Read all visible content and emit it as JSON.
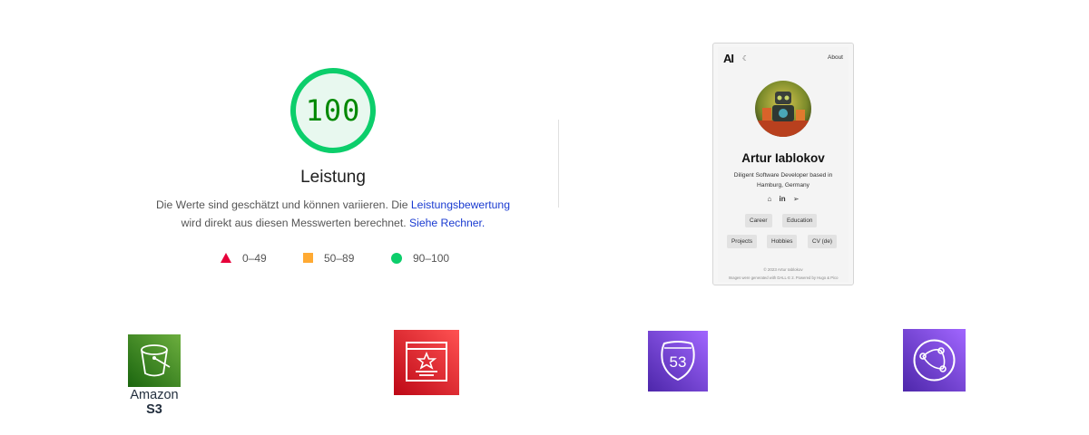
{
  "score": {
    "value": "100",
    "fraction": 1.0,
    "color": "#0cce6b",
    "category": "Leistung",
    "description_text": "Die Werte sind geschätzt und können variieren. Die ",
    "description_link1": "Leistungsbewertung",
    "description_text2": "wird direkt aus diesen Messwerten berechnet. ",
    "description_link2": "Siehe Rechner."
  },
  "legend": {
    "fail": {
      "label": "0–49",
      "color": "#e6003a",
      "icon": "triangle-icon"
    },
    "average": {
      "label": "50–89",
      "color": "#ffaa33",
      "icon": "square-icon"
    },
    "pass": {
      "label": "90–100",
      "color": "#0cce6b",
      "icon": "circle-icon"
    }
  },
  "screenshot": {
    "logo": "AI",
    "about": "About",
    "name": "Artur Iablokov",
    "bio_line1": "Diligent Software Developer based in",
    "bio_line2": "Hamburg, Germany",
    "icons": [
      "github-icon",
      "linkedin-icon",
      "telegram-icon"
    ],
    "chips": [
      "Career",
      "Education",
      "Projects",
      "Hobbies",
      "CV (de)"
    ],
    "footer1": "© 2023 Artur Iablokov",
    "footer2": "Images were generated with DALL·E 2. Powered by Hugo & Pico"
  },
  "aws": {
    "s3": {
      "icon": "amazon-s3-icon",
      "caption_line1": "Amazon",
      "caption_line2": "S3",
      "color": "#3f8624"
    },
    "certificate": {
      "icon": "aws-certificate-manager-icon",
      "color": "#c7131f"
    },
    "route53": {
      "icon": "amazon-route-53-icon",
      "badge": "53",
      "color": "#4d27aa"
    },
    "cloudfront": {
      "icon": "amazon-cloudfront-icon",
      "color": "#5a30b5"
    }
  }
}
